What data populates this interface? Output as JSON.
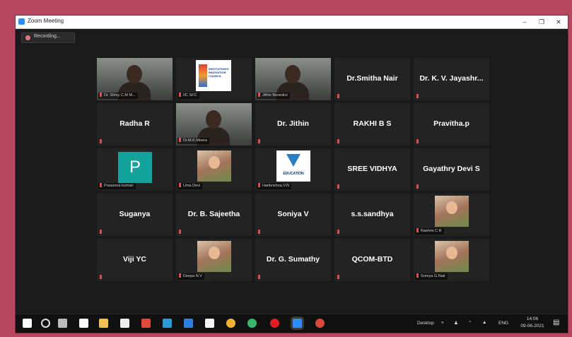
{
  "window": {
    "title": "Zoom Meeting"
  },
  "recording": {
    "label": "Recording..."
  },
  "participants": [
    {
      "label": "Dr. Shiny C.M M...",
      "kind": "video"
    },
    {
      "label": "IIC SFC",
      "kind": "logo"
    },
    {
      "label": "Jithin Benedict",
      "kind": "video"
    },
    {
      "label": "Dr.Smitha Nair",
      "kind": "name"
    },
    {
      "label": "Dr. K. V. Jayashr...",
      "kind": "name"
    },
    {
      "label": "Radha R",
      "kind": "name"
    },
    {
      "label": "Dr.M.K.Meera",
      "kind": "video",
      "active": true
    },
    {
      "label": "Dr. Jithin",
      "kind": "name"
    },
    {
      "label": "RAKHI B S",
      "kind": "name"
    },
    {
      "label": "Pravitha.p",
      "kind": "name"
    },
    {
      "label": "Prasanna kumari",
      "kind": "avatar",
      "avatar_letter": "P"
    },
    {
      "label": "Uma Devi",
      "kind": "photo"
    },
    {
      "label": "Harikrishna.V.N",
      "kind": "logo2"
    },
    {
      "label": "SREE VIDHYA",
      "kind": "name"
    },
    {
      "label": "Gayathry Devi S",
      "kind": "name"
    },
    {
      "label": "Suganya",
      "kind": "name"
    },
    {
      "label": "Dr. B. Sajeetha",
      "kind": "name"
    },
    {
      "label": "Soniya V",
      "kind": "name"
    },
    {
      "label": "s.s.sandhya",
      "kind": "name"
    },
    {
      "label": "Rashmi C R",
      "kind": "photo"
    },
    {
      "label": "Viji YC",
      "kind": "name"
    },
    {
      "label": "Deepa N.V",
      "kind": "photo"
    },
    {
      "label": "Dr. G. Sumathy",
      "kind": "name"
    },
    {
      "label": "QCOM-BTD",
      "kind": "name"
    },
    {
      "label": "Sreeya G.Nair",
      "kind": "photo"
    }
  ],
  "logos": {
    "iic_text": "INSTITUTION'S INNOVATION COUNCIL",
    "education_text": "EDUCATION"
  },
  "taskbar": {
    "apps": [
      "windows-start",
      "search",
      "task-view",
      "mail",
      "files",
      "store",
      "office",
      "ludo",
      "edge",
      "word",
      "chrome",
      "app-green",
      "opera",
      "zoom",
      "chrome-2"
    ],
    "desktop_label": "Desktop",
    "lang": "ENG",
    "time": "14:06",
    "date": "09-06-2021"
  },
  "colors": {
    "page_bg": "#b5485f",
    "meeting_bg": "#1a1a1a",
    "tile_bg": "#232323",
    "active_border": "#9bd23c",
    "muted": "#e84b4b"
  }
}
